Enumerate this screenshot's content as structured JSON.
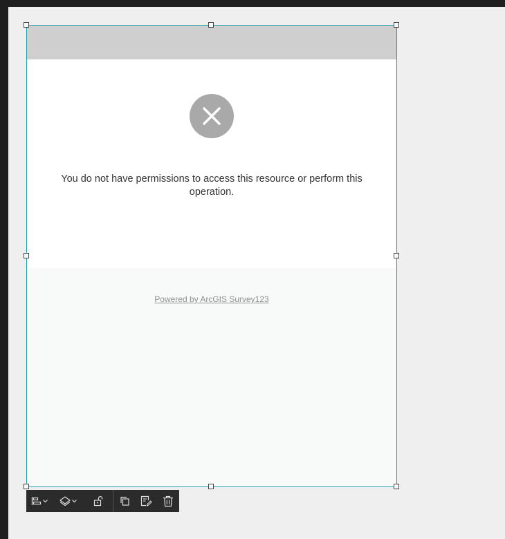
{
  "error": {
    "message": "You do not have permissions to access this resource or perform this operation."
  },
  "footer": {
    "powered_by": "Powered by ArcGIS Survey123"
  },
  "toolbar": {
    "buttons": [
      {
        "name": "align",
        "icon": "align-left-icon",
        "has_dropdown": true
      },
      {
        "name": "arrange",
        "icon": "layers-icon",
        "has_dropdown": true
      },
      {
        "name": "lock",
        "icon": "unlock-icon"
      },
      {
        "name": "duplicate",
        "icon": "copy-icon"
      },
      {
        "name": "edit",
        "icon": "edit-form-icon"
      },
      {
        "name": "delete",
        "icon": "trash-icon"
      }
    ]
  },
  "colors": {
    "selection": "#1ba0a8",
    "toolbar_bg": "#2b2b2b",
    "error_icon": "#a9a9a9"
  }
}
